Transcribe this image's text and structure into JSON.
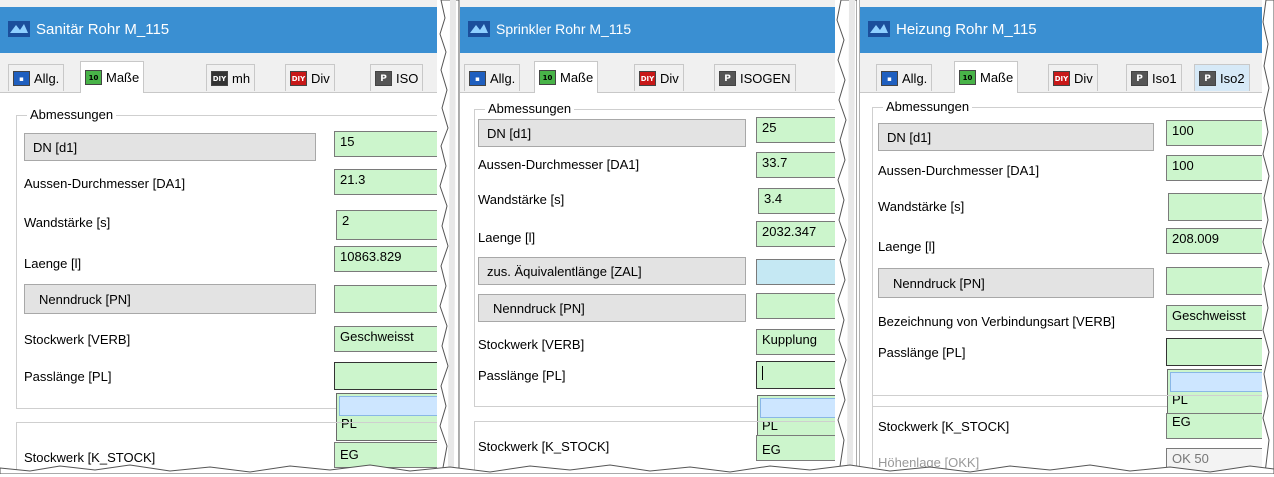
{
  "colors": {
    "titlebar": "#3a8fd2",
    "field_green": "#ccf5cc",
    "field_blue": "#c5e8f3",
    "label_grey": "#e3e3e3"
  },
  "panels": [
    {
      "title": "Sanitär Rohr M_115",
      "tabs": [
        {
          "icon": "allg-tab-icon",
          "glyph": "▪",
          "label": "Allg."
        },
        {
          "icon": "masse-tab-icon",
          "glyph": "10",
          "label": "Maße"
        },
        {
          "icon": "diy-tab-icon",
          "glyph": "DIY",
          "label": "mh"
        },
        {
          "icon": "div-tab-icon",
          "glyph": "DIY",
          "label": "Div"
        },
        {
          "icon": "p-tab-icon",
          "glyph": "P",
          "label": "ISO"
        }
      ],
      "group_title": "Abmessungen",
      "rows": [
        {
          "label": "DN [d1]",
          "value": "15"
        },
        {
          "label": "Aussen-Durchmesser [DA1]",
          "value": "21.3"
        },
        {
          "label": "Wandstärke [s]",
          "value": "2"
        },
        {
          "label": "Laenge [l]",
          "value": "10863.829"
        },
        {
          "label": "Nenndruck [PN]",
          "value": ""
        },
        {
          "label": "Stockwerk [VERB]",
          "value": "Geschweisst"
        },
        {
          "label": "Passlänge [PL]",
          "value": ""
        }
      ],
      "dropdown_option": "PL",
      "lower_rows": [
        {
          "label": "Stockwerk [K_STOCK]",
          "value": "EG"
        }
      ]
    },
    {
      "title": "Sprinkler Rohr M_115",
      "tabs": [
        {
          "icon": "allg-tab-icon",
          "glyph": "▪",
          "label": "Allg."
        },
        {
          "icon": "masse-tab-icon",
          "glyph": "10",
          "label": "Maße"
        },
        {
          "icon": "div-tab-icon",
          "glyph": "DIY",
          "label": "Div"
        },
        {
          "icon": "p-tab-icon",
          "glyph": "P",
          "label": "ISOGEN"
        }
      ],
      "group_title": "Abmessungen",
      "rows": [
        {
          "label": "DN [d1]",
          "value": "25"
        },
        {
          "label": "Aussen-Durchmesser [DA1]",
          "value": "33.7"
        },
        {
          "label": "Wandstärke [s]",
          "value": "3.4"
        },
        {
          "label": "Laenge [l]",
          "value": "2032.347"
        },
        {
          "label": "zus. Äquivalentlänge [ZAL]",
          "value": ""
        },
        {
          "label": "Nenndruck [PN]",
          "value": ""
        },
        {
          "label": "Stockwerk [VERB]",
          "value": "Kupplung"
        },
        {
          "label": "Passlänge [PL]",
          "value": ""
        }
      ],
      "dropdown_option": "PL",
      "lower_rows": [
        {
          "label": "Stockwerk [K_STOCK]",
          "value": "EG"
        }
      ]
    },
    {
      "title": "Heizung Rohr M_115",
      "tabs": [
        {
          "icon": "allg-tab-icon",
          "glyph": "▪",
          "label": "Allg."
        },
        {
          "icon": "masse-tab-icon",
          "glyph": "10",
          "label": "Maße"
        },
        {
          "icon": "div-tab-icon",
          "glyph": "DIY",
          "label": "Div"
        },
        {
          "icon": "p-tab-icon",
          "glyph": "P",
          "label": "Iso1"
        },
        {
          "icon": "p-tab-icon",
          "glyph": "P",
          "label": "Iso2"
        }
      ],
      "group_title": "Abmessungen",
      "rows": [
        {
          "label": "DN [d1]",
          "value": "100"
        },
        {
          "label": "Aussen-Durchmesser [DA1]",
          "value": "100"
        },
        {
          "label": "Wandstärke [s]",
          "value": ""
        },
        {
          "label": "Laenge [l]",
          "value": "208.009"
        },
        {
          "label": "Nenndruck [PN]",
          "value": ""
        },
        {
          "label": "Bezeichnung von Verbindungsart [VERB]",
          "value": "Geschweisst"
        },
        {
          "label": "Passlänge [PL]",
          "value": ""
        }
      ],
      "dropdown_option": "PL",
      "lower_rows": [
        {
          "label": "Stockwerk [K_STOCK]",
          "value": "EG"
        },
        {
          "label": "Höhenlage [OKK]",
          "value": "OK 50"
        }
      ]
    }
  ]
}
